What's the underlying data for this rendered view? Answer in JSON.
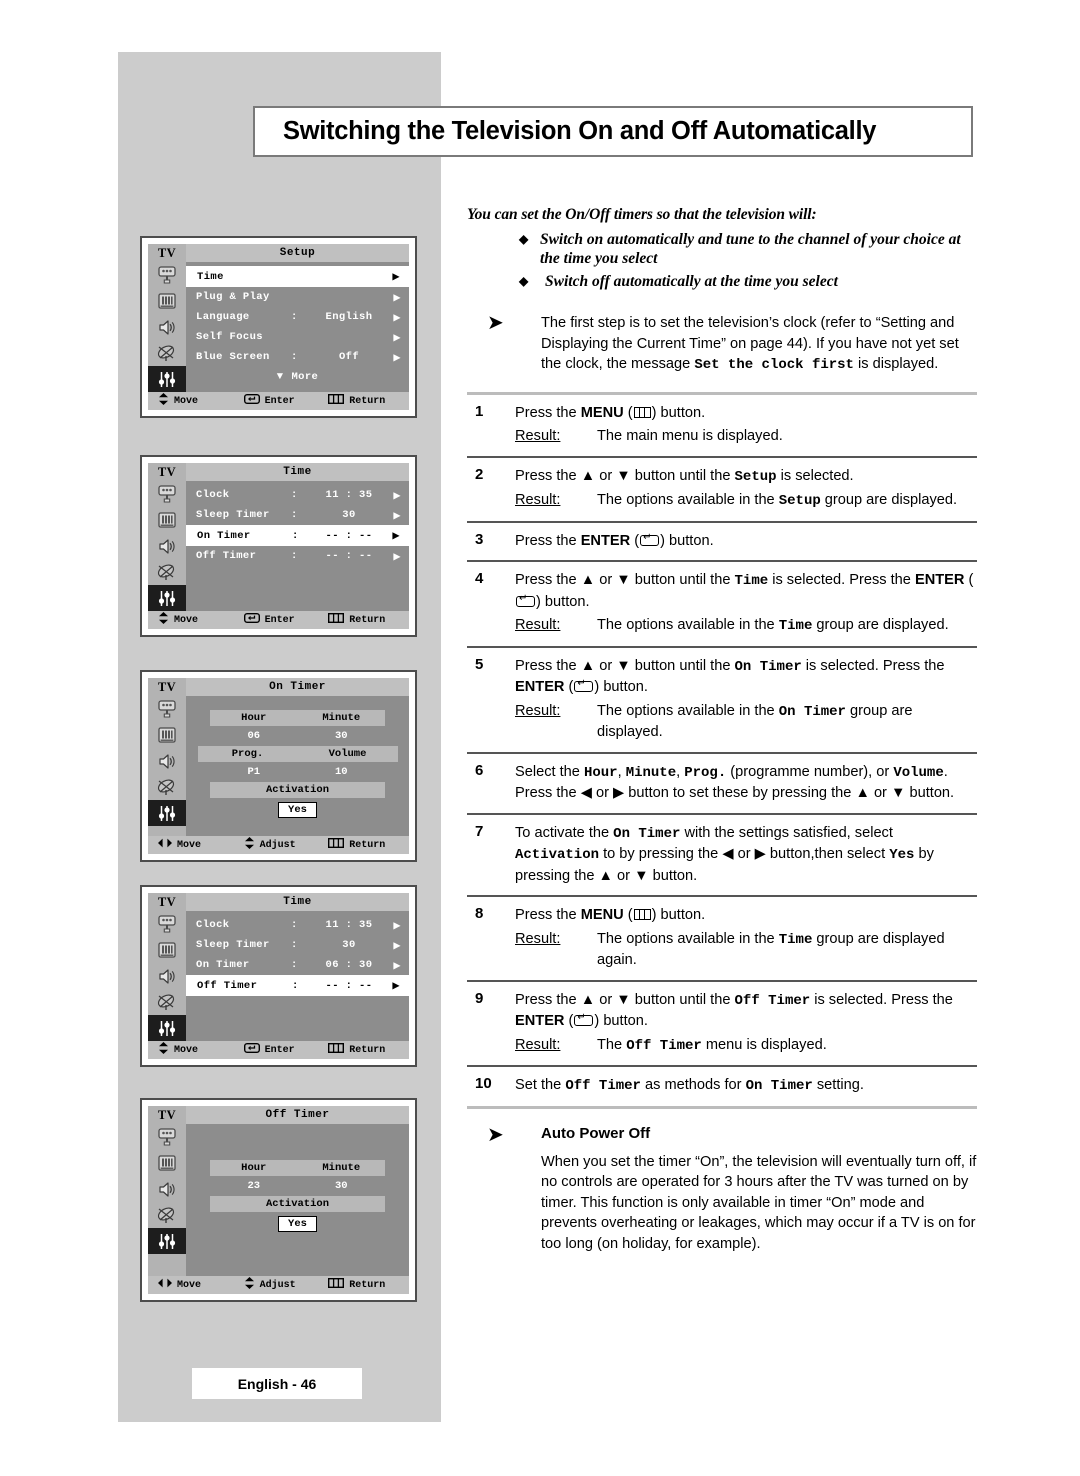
{
  "page": {
    "title": "Switching the Television On and Off Automatically",
    "footer_tag": "English - 46"
  },
  "intro": {
    "lead": "You can set the On/Off timers so that the television will:",
    "bullets": [
      "Switch on automatically and tune to the channel of your choice at the time you select",
      "Switch off automatically at the time you select"
    ],
    "note_pre": "The first step is to set the television’s clock (refer to “Setting and Displaying the Current Time” on page 44). If you have not yet set the clock,  the message ",
    "note_mono": "Set the clock first",
    "note_post": " is displayed."
  },
  "steps": [
    {
      "num": "1",
      "text_a": "Press the ",
      "bold_a": "MENU",
      "icon": "menu-icon",
      "text_b": " button.",
      "result_label": "Result:",
      "result": "The main menu is displayed."
    },
    {
      "num": "2",
      "text_a": "Press the ▲ or ▼ button until the ",
      "mono_a": "Setup",
      "text_b": " is selected.",
      "result_label": "Result:",
      "result_a": "The options available in the ",
      "result_mono": "Setup",
      "result_b": " group are displayed."
    },
    {
      "num": "3",
      "text_a": "Press the ",
      "bold_a": "ENTER",
      "icon": "enter-icon",
      "text_b": " button."
    },
    {
      "num": "4",
      "text_a": "Press the ▲ or ▼ button until the ",
      "mono_a": "Time",
      "text_b": " is selected. Press the ",
      "bold_a": "ENTER",
      "icon": "enter-icon",
      "text_c": " button.",
      "result_label": "Result:",
      "result_a": "The options available in the ",
      "result_mono": "Time",
      "result_b": " group are displayed."
    },
    {
      "num": "5",
      "text_a": "Press the ▲ or ▼ button until the ",
      "mono_a": "On Timer",
      "text_b": " is selected. Press the ",
      "bold_a": "ENTER",
      "icon": "enter-icon",
      "text_c": " button.",
      "result_label": "Result:",
      "result_a": "The options available in the ",
      "result_mono": "On Timer",
      "result_b": " group are displayed."
    },
    {
      "num": "6",
      "text_a": "Select the ",
      "mono_a": "Hour",
      "text_b": ", ",
      "mono_b": "Minute",
      "text_c": ", ",
      "mono_c": "Prog.",
      "text_d": " (programme number), or ",
      "mono_d": "Volume",
      "text_e": ". Press the ◀ or ▶ button to set these by pressing the ▲ or ▼ button."
    },
    {
      "num": "7",
      "text_a": "To activate the ",
      "mono_a": "On Timer",
      "text_b": " with the settings satisfied, select ",
      "mono_b": "Activation",
      "text_c": " to by pressing the ◀ or ▶ button,then select ",
      "mono_c": "Yes",
      "text_d": " by pressing the ▲ or ▼ button."
    },
    {
      "num": "8",
      "text_a": "Press the ",
      "bold_a": "MENU",
      "icon": "menu-icon",
      "text_b": " button.",
      "result_label": "Result:",
      "result_a": "The options available in the ",
      "result_mono": "Time",
      "result_b": " group are displayed again."
    },
    {
      "num": "9",
      "text_a": "Press the ▲ or ▼ button until the ",
      "mono_a": "Off Timer",
      "text_b": " is selected. Press the ",
      "bold_a": "ENTER",
      "icon": "enter-icon",
      "text_c": " button.",
      "result_label": "Result:",
      "result_a": "The ",
      "result_mono": "Off Timer",
      "result_b": " menu is displayed."
    },
    {
      "num": "10",
      "text_a": "Set the ",
      "mono_a": "Off Timer",
      "text_b": " as methods for ",
      "mono_b": "On Timer",
      "text_c": " setting."
    }
  ],
  "auto_power_off": {
    "title": "Auto Power Off",
    "text": "When you set the timer “On”, the television will eventually turn off, if no controls are operated for 3 hours after the TV was turned on by timer. This function is only available in timer “On” mode and prevents overheating or leakages, which may occur if a TV is on for too long (on holiday, for example)."
  },
  "osd_panels": [
    {
      "tv_label": "TV",
      "title": "Setup",
      "rows": [
        {
          "label": "Time",
          "colon": "",
          "value": "",
          "arrow": "▶",
          "selected": true
        },
        {
          "label": "Plug & Play",
          "colon": "",
          "value": "",
          "arrow": "▶",
          "selected": false
        },
        {
          "label": "Language",
          "colon": ":",
          "value": "English",
          "arrow": "▶",
          "selected": false
        },
        {
          "label": "Self Focus",
          "colon": "",
          "value": "",
          "arrow": "▶",
          "selected": false
        },
        {
          "label": "Blue Screen",
          "colon": ":",
          "value": "Off",
          "arrow": "▶",
          "selected": false
        }
      ],
      "more": "More",
      "footer": [
        {
          "icon": "updown-icon",
          "label": "Move"
        },
        {
          "icon": "enter-icon",
          "label": "Enter"
        },
        {
          "icon": "menu-icon",
          "label": "Return"
        }
      ]
    },
    {
      "tv_label": "TV",
      "title": "Time",
      "rows": [
        {
          "label": "Clock",
          "colon": ":",
          "value": "11 : 35",
          "arrow": "▶",
          "selected": false
        },
        {
          "label": "Sleep Timer",
          "colon": ":",
          "value": "30",
          "arrow": "▶",
          "selected": false
        },
        {
          "label": "On Timer",
          "colon": ":",
          "value": "-- : --",
          "arrow": "▶",
          "selected": true
        },
        {
          "label": "Off Timer",
          "colon": ":",
          "value": "-- : --",
          "arrow": "▶",
          "selected": false
        }
      ],
      "footer": [
        {
          "icon": "updown-icon",
          "label": "Move"
        },
        {
          "icon": "enter-icon",
          "label": "Enter"
        },
        {
          "icon": "menu-icon",
          "label": "Return"
        }
      ]
    },
    {
      "tv_label": "TV",
      "title": "On Timer",
      "grid": {
        "hdr1": [
          "Hour",
          "Minute"
        ],
        "val1": [
          "06",
          "30"
        ],
        "hdr2": [
          "Prog.",
          "Volume"
        ],
        "val2": [
          "P1",
          "10"
        ],
        "activation_label": "Activation",
        "activation_value": "Yes"
      },
      "footer": [
        {
          "icon": "leftright-icon",
          "label": "Move"
        },
        {
          "icon": "updown-icon",
          "label": "Adjust"
        },
        {
          "icon": "menu-icon",
          "label": "Return"
        }
      ]
    },
    {
      "tv_label": "TV",
      "title": "Time",
      "rows": [
        {
          "label": "Clock",
          "colon": ":",
          "value": "11 : 35",
          "arrow": "▶",
          "selected": false
        },
        {
          "label": "Sleep Timer",
          "colon": ":",
          "value": "30",
          "arrow": "▶",
          "selected": false
        },
        {
          "label": "On Timer",
          "colon": ":",
          "value": "06 : 30",
          "arrow": "▶",
          "selected": false
        },
        {
          "label": "Off Timer",
          "colon": ":",
          "value": "-- : --",
          "arrow": "▶",
          "selected": true
        }
      ],
      "footer": [
        {
          "icon": "updown-icon",
          "label": "Move"
        },
        {
          "icon": "enter-icon",
          "label": "Enter"
        },
        {
          "icon": "menu-icon",
          "label": "Return"
        }
      ]
    },
    {
      "tv_label": "TV",
      "title": "Off Timer",
      "grid": {
        "hdr1": [
          "Hour",
          "Minute"
        ],
        "val1": [
          "23",
          "30"
        ],
        "activation_label": "Activation",
        "activation_value": "Yes"
      },
      "footer": [
        {
          "icon": "leftright-icon",
          "label": "Move"
        },
        {
          "icon": "updown-icon",
          "label": "Adjust"
        },
        {
          "icon": "menu-icon",
          "label": "Return"
        }
      ]
    }
  ],
  "colors": {
    "panel_grey": "#cccccc",
    "osd_body": "#8d8d8d",
    "osd_rail": "#b3b3b3",
    "osd_header": "#c0c0c0",
    "osd_active": "#1d1d1d",
    "rule": "#555555"
  }
}
